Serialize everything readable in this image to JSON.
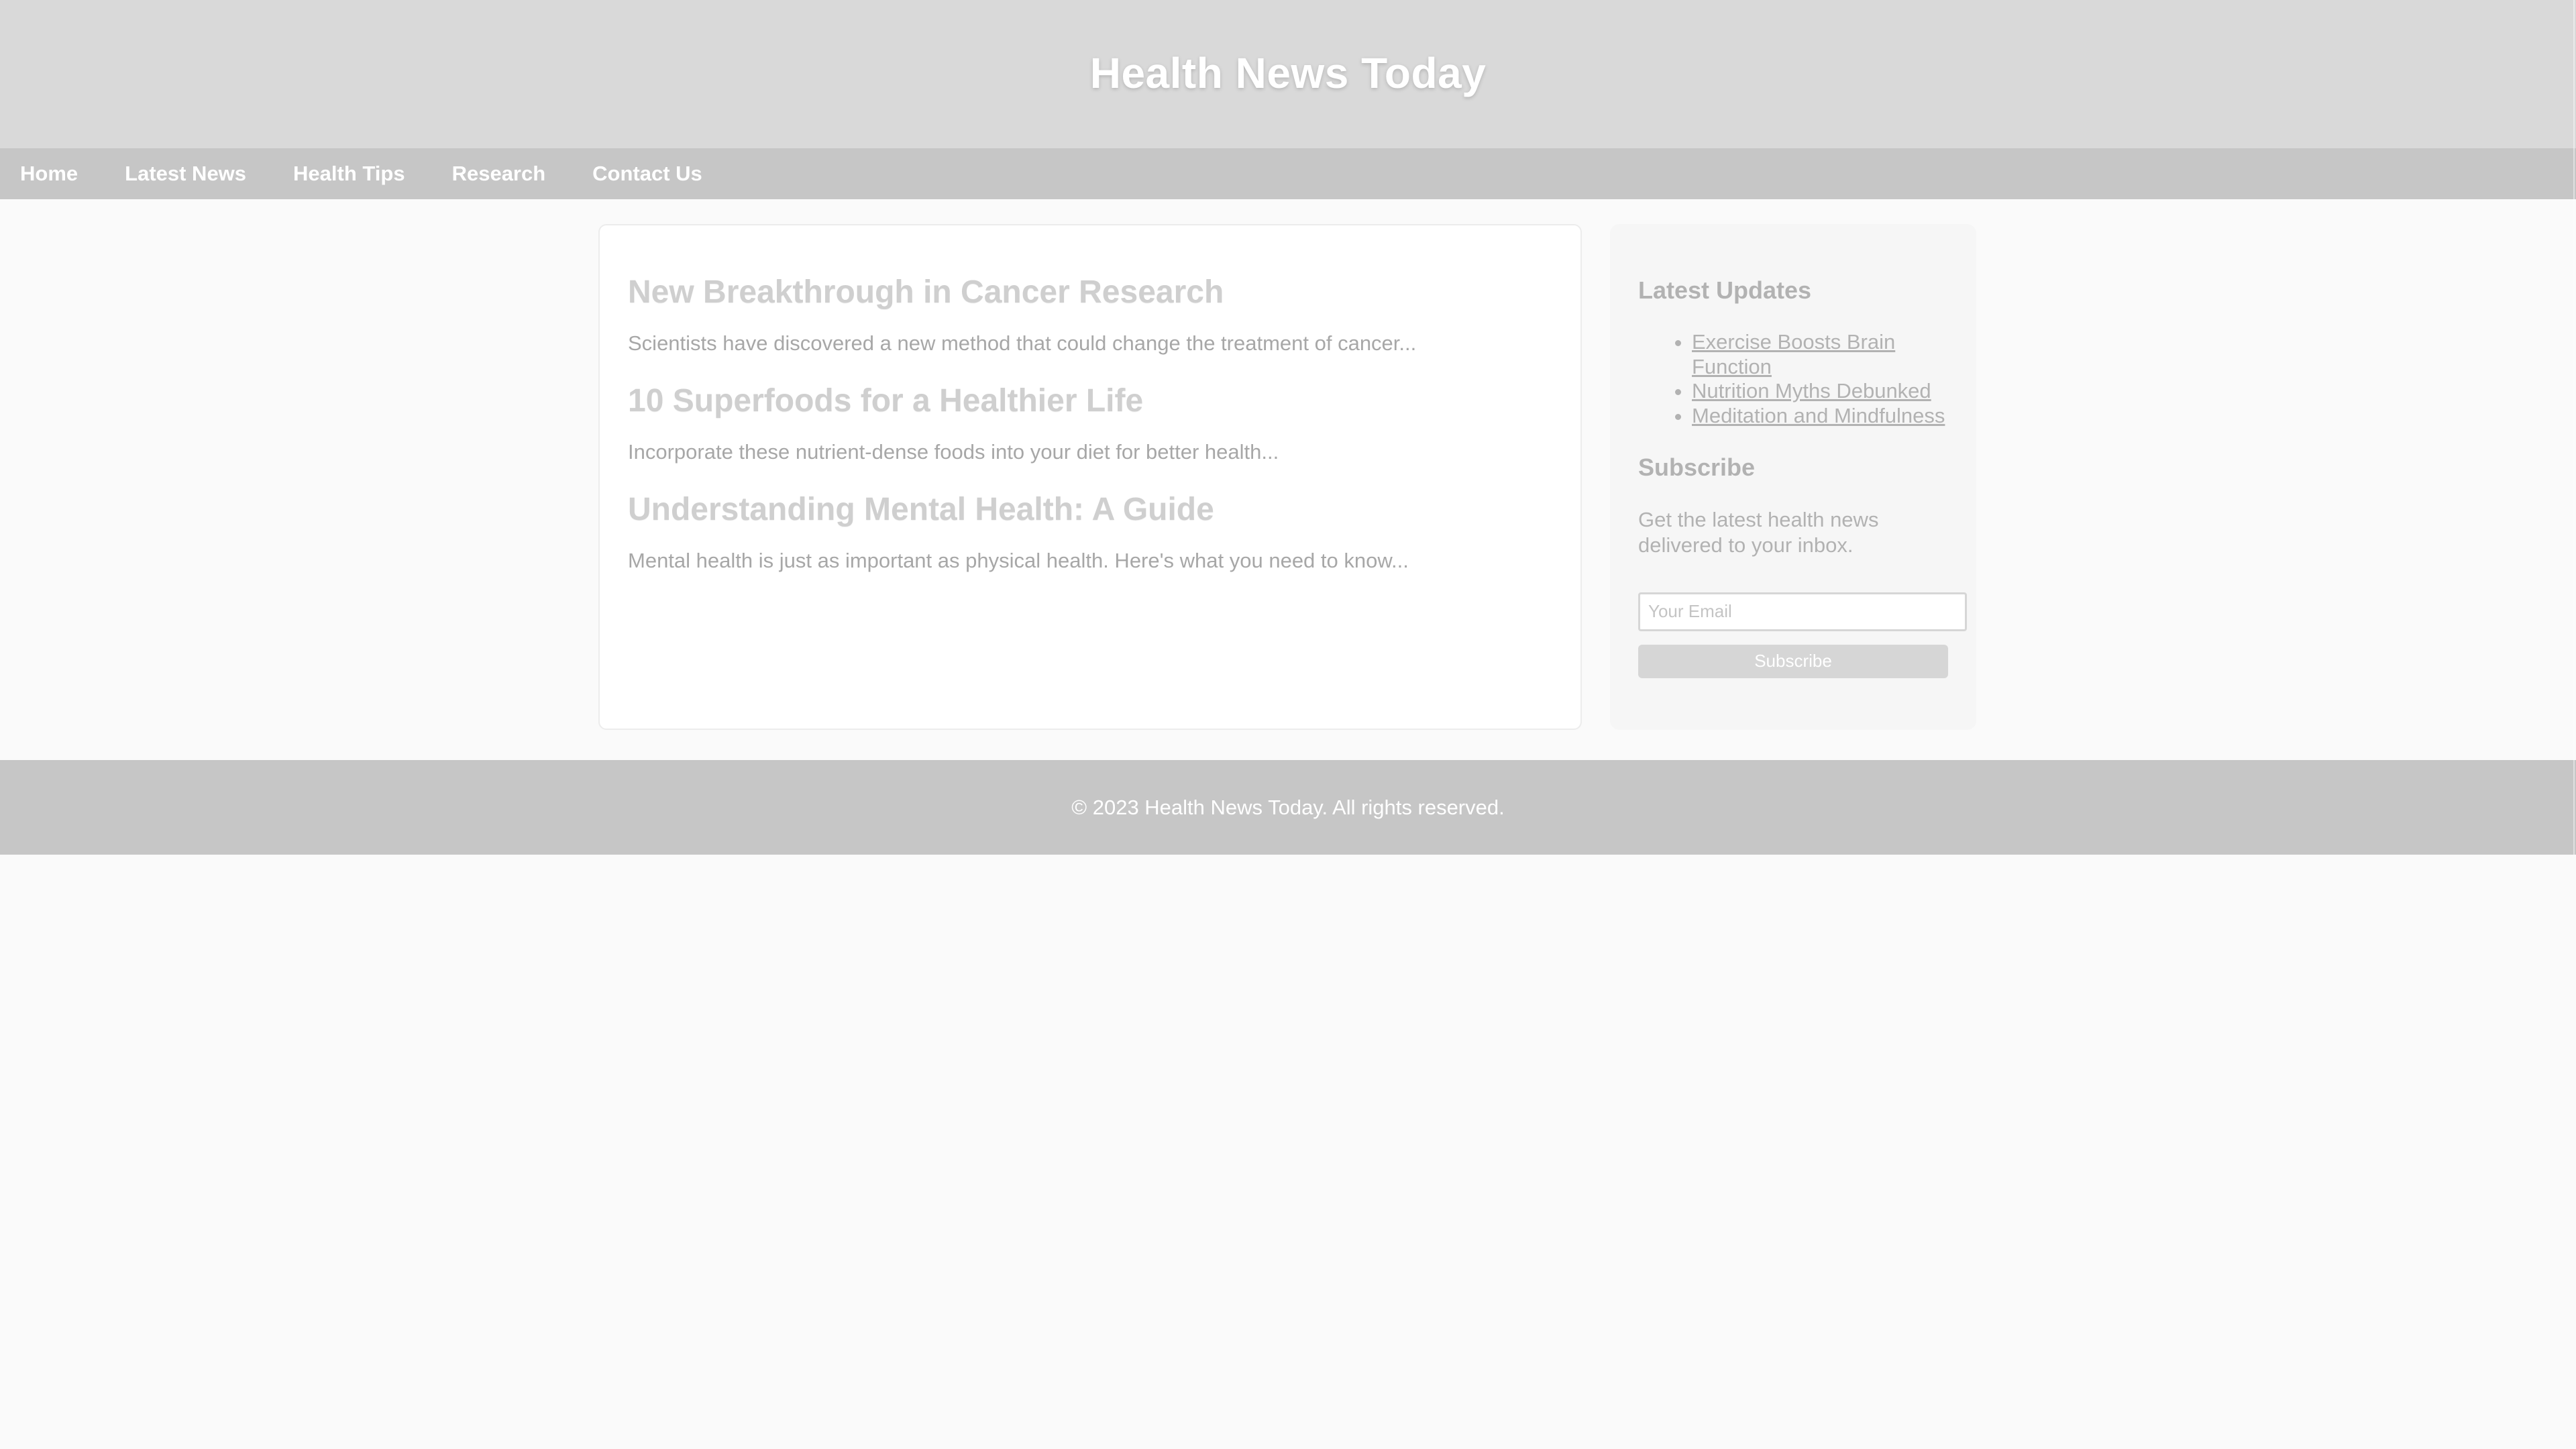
{
  "header": {
    "title": "Health News Today"
  },
  "nav": {
    "items": [
      {
        "label": "Home"
      },
      {
        "label": "Latest News"
      },
      {
        "label": "Health Tips"
      },
      {
        "label": "Research"
      },
      {
        "label": "Contact Us"
      }
    ]
  },
  "main": {
    "articles": [
      {
        "title": "New Breakthrough in Cancer Research",
        "excerpt": "Scientists have discovered a new method that could change the treatment of cancer..."
      },
      {
        "title": "10 Superfoods for a Healthier Life",
        "excerpt": "Incorporate these nutrient-dense foods into your diet for better health..."
      },
      {
        "title": "Understanding Mental Health: A Guide",
        "excerpt": "Mental health is just as important as physical health. Here's what you need to know..."
      }
    ]
  },
  "sidebar": {
    "latest_updates_heading": "Latest Updates",
    "latest_updates": [
      {
        "label": "Exercise Boosts Brain Function"
      },
      {
        "label": "Nutrition Myths Debunked"
      },
      {
        "label": "Meditation and Mindfulness"
      }
    ],
    "subscribe_heading": "Subscribe",
    "subscribe_text": "Get the latest health news delivered to your inbox.",
    "email_placeholder": "Your Email",
    "subscribe_button": "Subscribe"
  },
  "footer": {
    "text": "© 2023 Health News Today. All rights reserved."
  },
  "colors": {
    "header_bg": "#d9d9d9",
    "nav_bg": "#c6c6c6",
    "footer_bg": "#c6c6c6",
    "page_bg": "#fafafa"
  }
}
